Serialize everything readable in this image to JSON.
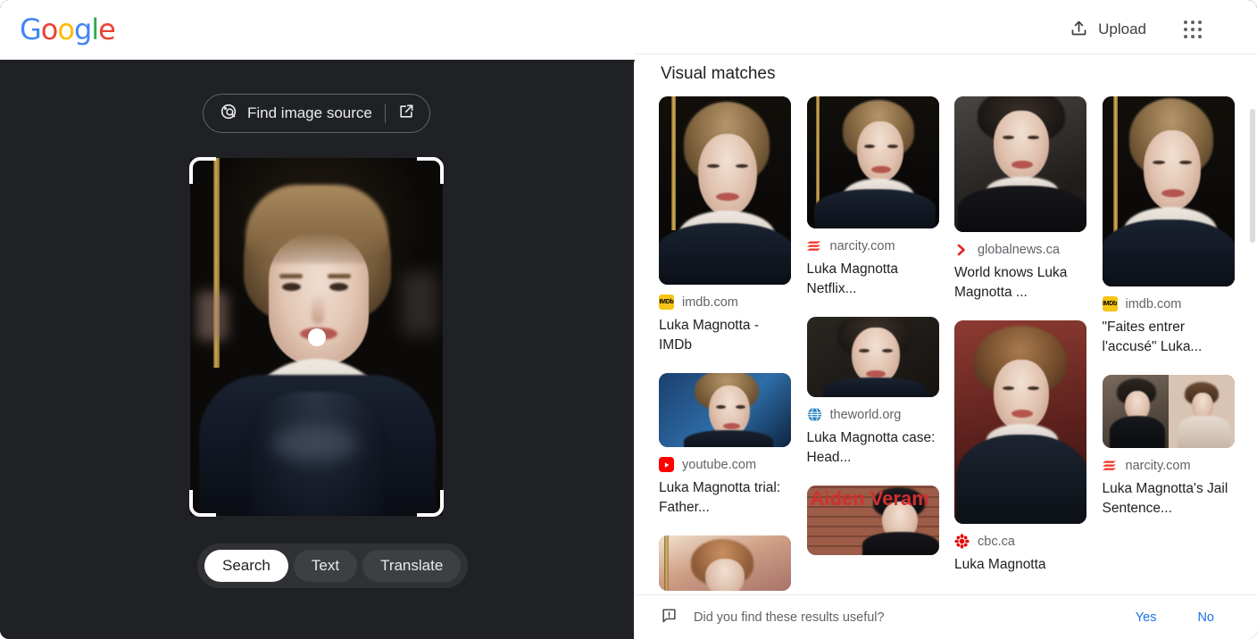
{
  "topbar": {
    "logo_text": "Google",
    "logo_colors": [
      "#4285F4",
      "#EA4335",
      "#FBBC05",
      "#4285F4",
      "#34A853",
      "#EA4335"
    ],
    "upload_label": "Upload",
    "upload_icon": "upload-arrow-icon",
    "apps_icon": "apps-grid-icon"
  },
  "left_pane": {
    "find_source": {
      "label": "Find image source",
      "lens_icon": "lens-search-icon",
      "external_icon": "open-in-new-icon"
    },
    "crop": {
      "handle": "center-drag-handle",
      "corners": [
        "top-left",
        "top-right",
        "bottom-left",
        "bottom-right"
      ]
    },
    "modes": [
      {
        "label": "Search",
        "active": true
      },
      {
        "label": "Text",
        "active": false
      },
      {
        "label": "Translate",
        "active": false
      }
    ]
  },
  "results": {
    "title": "Visual matches",
    "cards": [
      {
        "source": "imdb.com",
        "favicon": "imdb-favicon",
        "title": "Luka Magnotta - IMDb"
      },
      {
        "source": "narcity.com",
        "favicon": "narcity-favicon",
        "title": "Luka Magnotta Netflix..."
      },
      {
        "source": "globalnews.ca",
        "favicon": "globalnews-favicon",
        "title": "World knows Luka Magnotta ..."
      },
      {
        "source": "imdb.com",
        "favicon": "imdb-favicon",
        "title": "\"Faites entrer l'accusé\" Luka..."
      },
      {
        "source": "youtube.com",
        "favicon": "youtube-favicon",
        "title": "Luka Magnotta trial: Father..."
      },
      {
        "source": "theworld.org",
        "favicon": "theworld-favicon",
        "title": "Luka Magnotta case: Head..."
      },
      {
        "source": "cbc.ca",
        "favicon": "cbc-favicon",
        "title": "Luka Magnotta"
      },
      {
        "source": "narcity.com",
        "favicon": "narcity-favicon",
        "title": "Luka Magnotta's Jail Sentence..."
      }
    ],
    "overlay_texts": {
      "brick_photo": "Aiden Veram"
    }
  },
  "feedback": {
    "icon": "feedback-bubble-icon",
    "question": "Did you find these results useful?",
    "yes_label": "Yes",
    "no_label": "No",
    "link_color": "#1a73e8"
  }
}
